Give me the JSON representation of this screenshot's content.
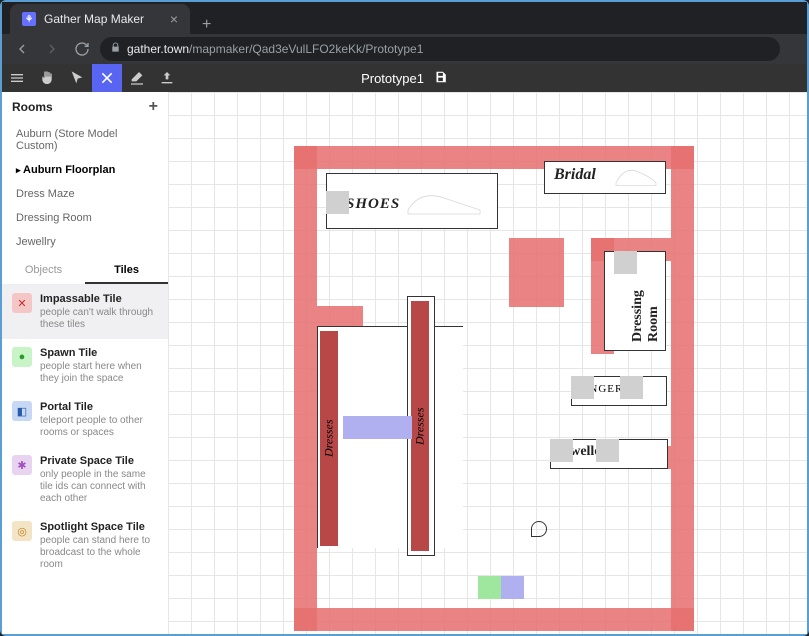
{
  "browser": {
    "tab_title": "Gather Map Maker",
    "url_host": "gather.town",
    "url_path": "/mapmaker/Qad3eVulLFO2keKk/Prototype1"
  },
  "app": {
    "title": "Prototype1"
  },
  "rooms": {
    "header": "Rooms",
    "items": [
      {
        "label": "Auburn (Store Model Custom)",
        "selected": false
      },
      {
        "label": "Auburn Floorplan",
        "selected": true
      },
      {
        "label": "Dress Maze",
        "selected": false
      },
      {
        "label": "Dressing Room",
        "selected": false
      },
      {
        "label": "Jewellry",
        "selected": false
      }
    ]
  },
  "object_tabs": {
    "objects": "Objects",
    "tiles": "Tiles",
    "active": "tiles"
  },
  "tiles": [
    {
      "id": "impassable",
      "title": "Impassable Tile",
      "desc": "people can't walk through these tiles",
      "icon_bg": "#f4c6c6",
      "icon_fg": "#c03030",
      "glyph": "✕",
      "selected": true
    },
    {
      "id": "spawn",
      "title": "Spawn Tile",
      "desc": "people start here when they join the space",
      "icon_bg": "#c8f4c8",
      "icon_fg": "#2a9a2a",
      "glyph": "●",
      "selected": false
    },
    {
      "id": "portal",
      "title": "Portal Tile",
      "desc": "teleport people to other rooms or spaces",
      "icon_bg": "#c6d8f4",
      "icon_fg": "#2a5aaa",
      "glyph": "◧",
      "selected": false
    },
    {
      "id": "private",
      "title": "Private Space Tile",
      "desc": "only people in the same tile ids can connect with each other",
      "icon_bg": "#e8d4f0",
      "icon_fg": "#a050c0",
      "glyph": "✱",
      "selected": false
    },
    {
      "id": "spotlight",
      "title": "Spotlight Space Tile",
      "desc": "people can stand here to broadcast to the whole room",
      "icon_bg": "#f4e4c6",
      "icon_fg": "#c08020",
      "glyph": "◎",
      "selected": false
    }
  ],
  "floorplan": {
    "sections": {
      "shoes": "SHOES",
      "bridal": "Bridal",
      "dressing_room": "Dressing Room",
      "lingerie": "LINGERIE",
      "jewellery": "Jewellery",
      "dresses": "Dresses"
    }
  },
  "colors": {
    "impassable": "#e66e6e",
    "spawn_green": "#9fe69f",
    "spawn_purple": "#b0b0f0",
    "accent": "#5865f2"
  }
}
